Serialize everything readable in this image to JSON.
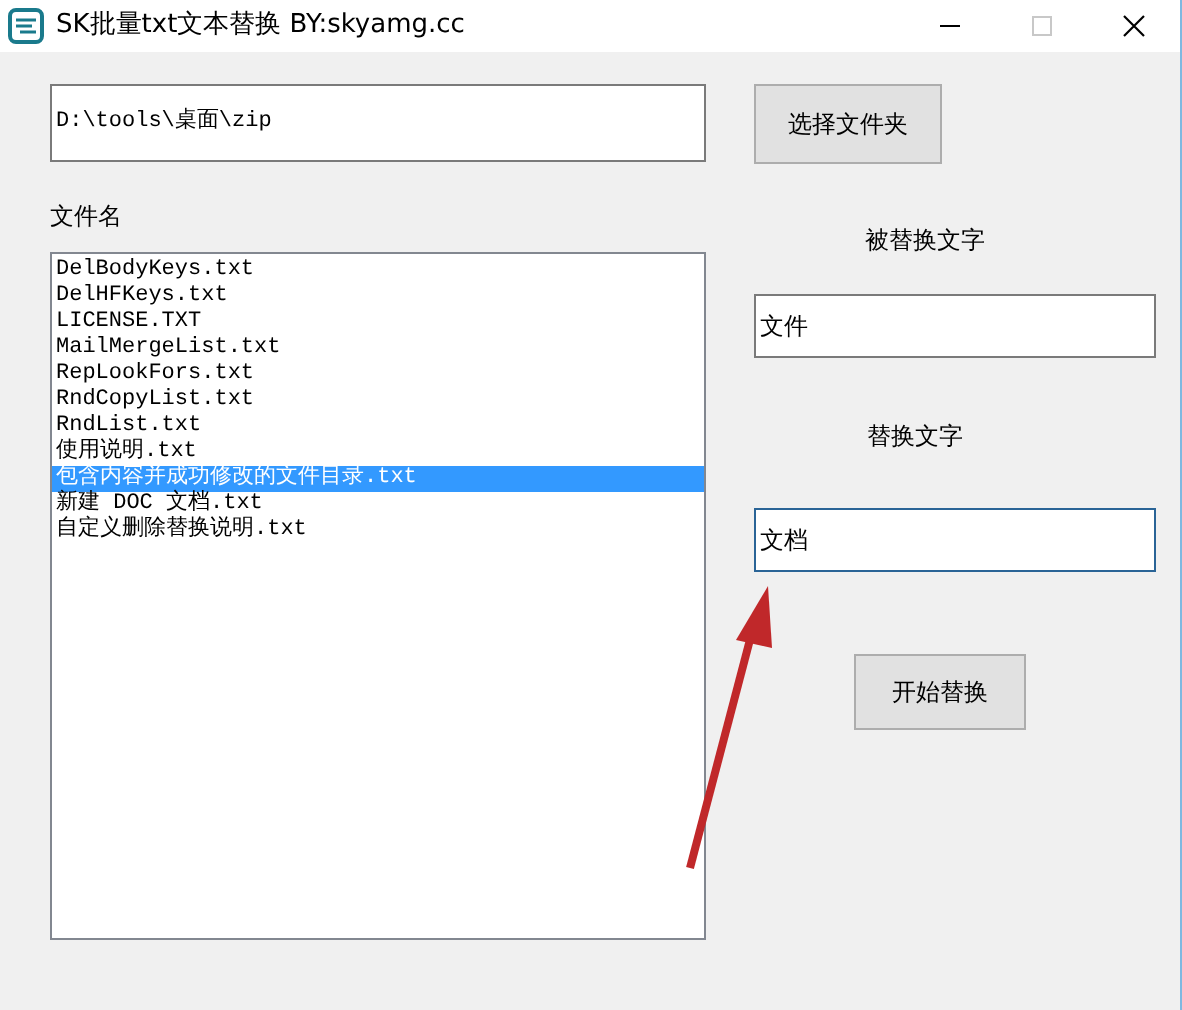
{
  "window": {
    "title": "SK批量txt文本替换 BY:skyamg.cc"
  },
  "folder": {
    "path": "D:\\tools\\桌面\\zip",
    "button": "选择文件夹"
  },
  "file_list": {
    "label": "文件名",
    "items": [
      {
        "name": "DelBodyKeys.txt",
        "selected": false
      },
      {
        "name": "DelHFKeys.txt",
        "selected": false
      },
      {
        "name": "LICENSE.TXT",
        "selected": false
      },
      {
        "name": "MailMergeList.txt",
        "selected": false
      },
      {
        "name": "RepLookFors.txt",
        "selected": false
      },
      {
        "name": "RndCopyList.txt",
        "selected": false
      },
      {
        "name": "RndList.txt",
        "selected": false
      },
      {
        "name": "使用说明.txt",
        "selected": false
      },
      {
        "name": "包含内容并成功修改的文件目录.txt",
        "selected": true
      },
      {
        "name": "新建 DOC 文档.txt",
        "selected": false
      },
      {
        "name": "自定义删除替换说明.txt",
        "selected": false
      }
    ]
  },
  "find": {
    "label": "被替换文字",
    "value": "文件"
  },
  "replace": {
    "label": "替换文字",
    "value": "文档",
    "focused": true
  },
  "start_button": "开始替换"
}
